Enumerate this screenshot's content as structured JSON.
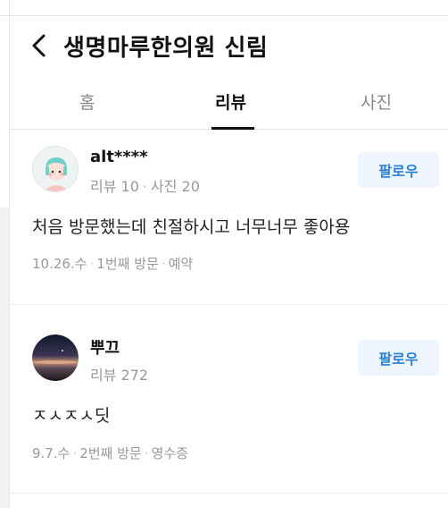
{
  "header": {
    "title": "생명마루한의원 신림"
  },
  "tabs": [
    {
      "label": "홈",
      "active": false
    },
    {
      "label": "리뷰",
      "active": true
    },
    {
      "label": "사진",
      "active": false
    }
  ],
  "reviews": [
    {
      "username": "alt****",
      "review_count_label": "리뷰 10",
      "photo_count_label": "사진 20",
      "follow_label": "팔로우",
      "text": "처음 방문했는데 친절하시고 너무너무 좋아용",
      "date": "10.26.수",
      "visit": "1번째 방문",
      "verification": "예약"
    },
    {
      "username": "뿌끄",
      "review_count_label": "리뷰 272",
      "follow_label": "팔로우",
      "text": "ㅈㅅㅈㅅ딧",
      "date": "9.7.수",
      "visit": "2번째 방문",
      "verification": "영수증"
    }
  ],
  "colors": {
    "accent": "#2a7fd4",
    "follow_bg": "#eef5fc",
    "muted_text": "#999999"
  }
}
